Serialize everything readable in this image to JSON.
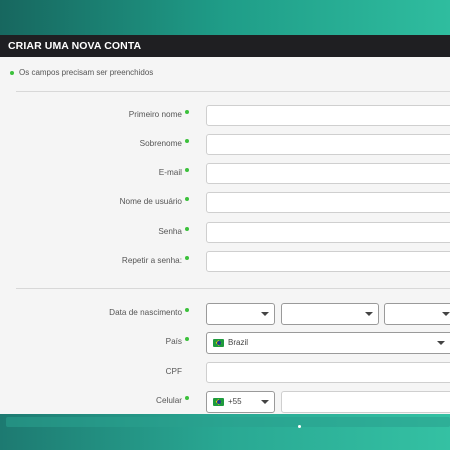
{
  "form": {
    "title": "CRIAR UMA NOVA CONTA",
    "required_note": "Os campos precisam ser preenchidos",
    "fields": {
      "first_name": "Primeiro nome",
      "last_name": "Sobrenome",
      "email": "E-mail",
      "username": "Nome de usuário",
      "password": "Senha",
      "repeat_password": "Repetir a senha:",
      "birthdate": "Data de nascimento",
      "country": "País",
      "cpf": "CPF",
      "phone": "Celular"
    },
    "country_value": "Brazil",
    "phone_code": "+55"
  },
  "colors": {
    "header_bg": "#1f1f22",
    "required_dot": "#3cc13c",
    "brand_teal": "#1f9d88"
  },
  "icons": {
    "flag": "brazil-flag-icon",
    "dropdown": "chevron-down-icon"
  }
}
